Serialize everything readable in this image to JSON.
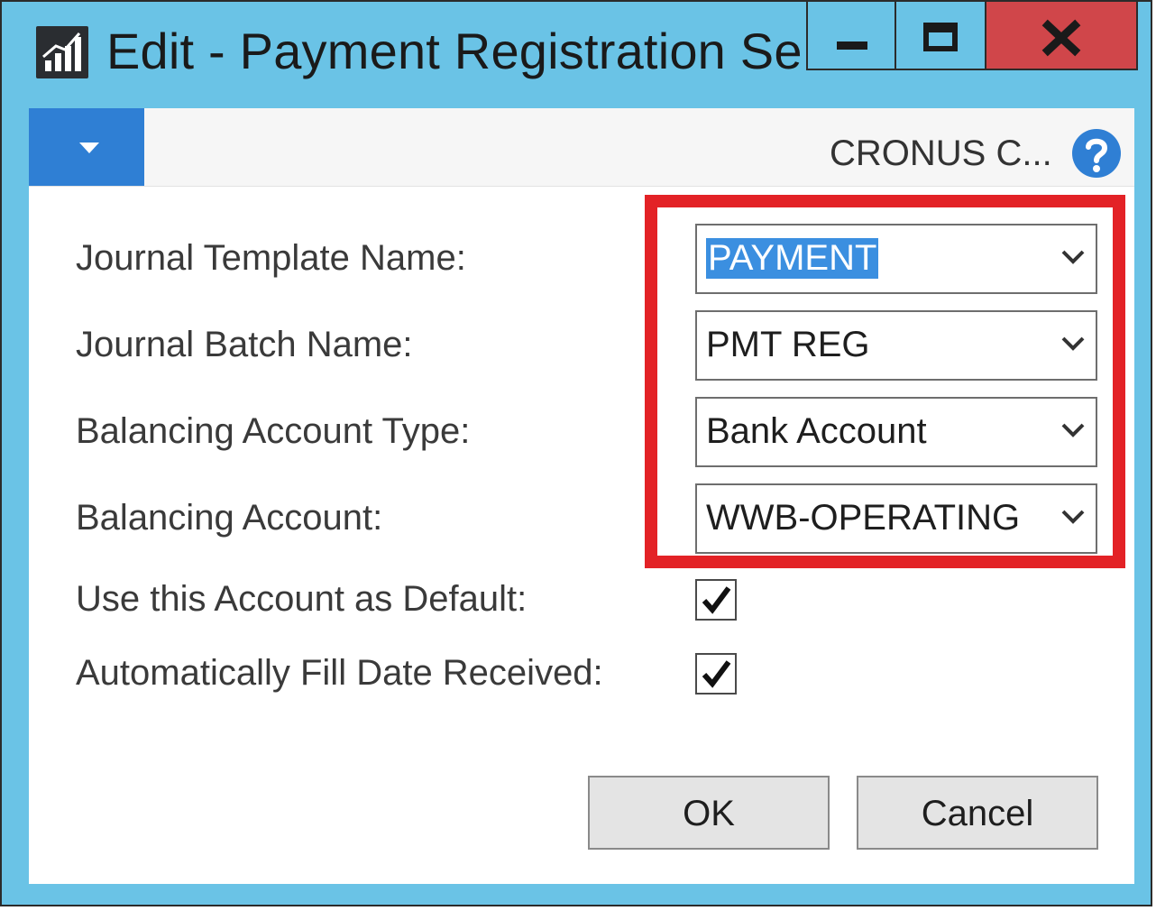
{
  "window": {
    "title": "Edit - Payment Registration Se...",
    "controls": {
      "minimize": "minimize-icon",
      "maximize": "maximize-icon",
      "close": "close-icon"
    },
    "colors": {
      "frame": "#6ac3e6",
      "close": "#d0464a",
      "menu": "#2f7fd4",
      "highlight": "#e32226"
    }
  },
  "ribbon": {
    "menu_icon": "chevron-down-icon",
    "company": "CRONUS C...",
    "help_icon": "help-icon"
  },
  "form": {
    "fields": [
      {
        "label": "Journal Template Name:",
        "value": "PAYMENT"
      },
      {
        "label": "Journal Batch Name:",
        "value": "PMT REG"
      },
      {
        "label": "Balancing Account Type:",
        "value": "Bank Account"
      },
      {
        "label": "Balancing Account:",
        "value": "WWB-OPERATING"
      }
    ],
    "checkboxes": [
      {
        "label": "Use this Account as Default:",
        "checked": true
      },
      {
        "label": "Automatically Fill Date Received:",
        "checked": true
      }
    ]
  },
  "buttons": {
    "ok": "OK",
    "cancel": "Cancel"
  }
}
